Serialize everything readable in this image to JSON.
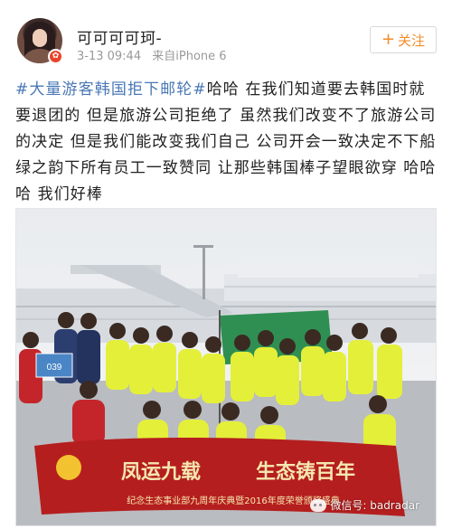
{
  "post": {
    "username": "可可可可珂-",
    "timestamp": "3-13 09:44",
    "source": "来自iPhone 6",
    "follow_label": "关注",
    "follow_icon": "plus-icon",
    "hashtag": "#大量游客韩国拒下邮轮#",
    "body": "哈哈 在我们知道要去韩国时就要退团的 但是旅游公司拒绝了 虽然我们改变不了旅游公司的决定 但是我们能改变我们自己 公司开会一致决定不下船 绿之韵下所有员工一致赞同 让那些韩国棒子望眼欲穿 哈哈哈 我们好棒"
  },
  "photo": {
    "sign_number": "039",
    "banner_main_left": "凤运九载",
    "banner_main_right": "生态铸百年",
    "banner_sub": "纪念生态事业部九周年庆典暨2016年度荣誉颁奖盛典"
  },
  "watermark": {
    "text": "微信号: badradar",
    "icon": "wechat-icon"
  },
  "colors": {
    "hashtag": "#4a78b5",
    "follow_text": "#f28c28",
    "banner_red": "#b51e1e",
    "jacket_yellow": "#e4ef3a",
    "flag_green": "#2f8f52"
  }
}
